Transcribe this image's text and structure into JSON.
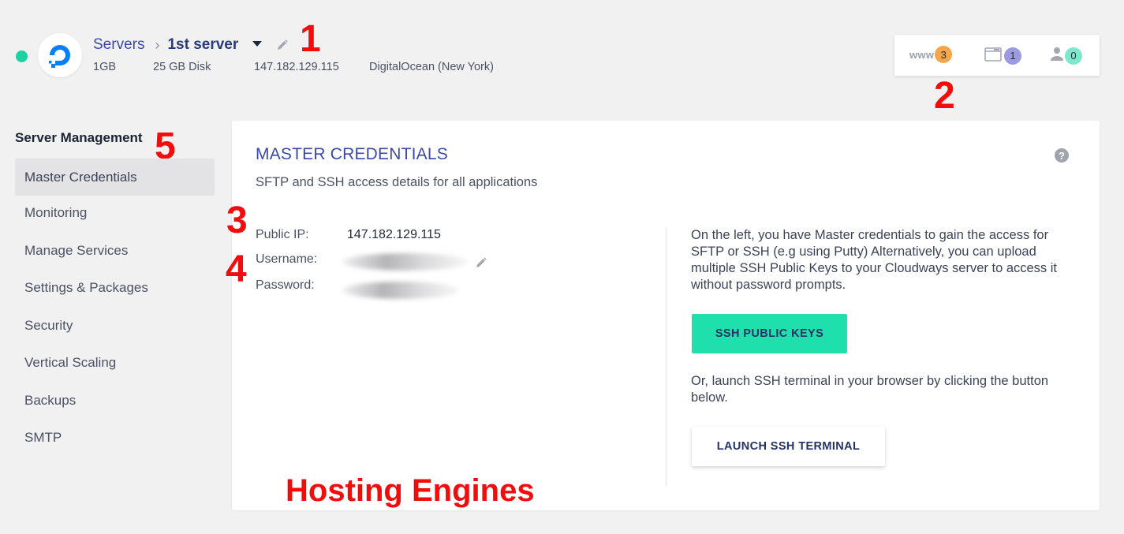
{
  "header": {
    "breadcrumb_root": "Servers",
    "breadcrumb_sep": "›",
    "server_name": "1st server",
    "memory": "1GB",
    "disk": "25 GB Disk",
    "ip": "147.182.129.115",
    "provider": "DigitalOcean (New York)",
    "status_color": "#1ed1a3"
  },
  "stats": {
    "www_label": "www",
    "apps_count": "3",
    "apps_color": "#f5a64a",
    "files_count": "1",
    "files_color": "#9c9be0",
    "users_count": "0",
    "users_color": "#7ee8cc"
  },
  "annotations": {
    "n1": "1",
    "n2": "2",
    "n3": "3",
    "n4": "4",
    "n5": "5",
    "watermark": "Hosting Engines"
  },
  "sidebar": {
    "heading": "Server Management",
    "items": [
      {
        "label": "Master Credentials",
        "active": true
      },
      {
        "label": "Monitoring"
      },
      {
        "label": "Manage Services"
      },
      {
        "label": "Settings & Packages"
      },
      {
        "label": "Security"
      },
      {
        "label": "Vertical Scaling"
      },
      {
        "label": "Backups"
      },
      {
        "label": "SMTP"
      }
    ]
  },
  "main": {
    "title": "MASTER CREDENTIALS",
    "subtitle": "SFTP and SSH access details for all applications",
    "help_glyph": "?",
    "public_ip_label": "Public IP:",
    "public_ip_value": "147.182.129.115",
    "username_label": "Username:",
    "password_label": "Password:",
    "info_text": "On the left, you have Master credentials to gain the access for SFTP or SSH (e.g using Putty) Alternatively, you can upload multiple SSH Public Keys to your Cloudways server to access it without password prompts.",
    "ssh_keys_button": "SSH PUBLIC KEYS",
    "terminal_text": "Or, launch SSH terminal in your browser by clicking the button below.",
    "terminal_button": "LAUNCH SSH TERMINAL"
  },
  "icons": {
    "logo": "digitalocean-logo",
    "edit": "pencil-icon",
    "caret": "caret-down-icon",
    "files": "folder-icon",
    "users": "user-icon",
    "help": "help-icon"
  }
}
